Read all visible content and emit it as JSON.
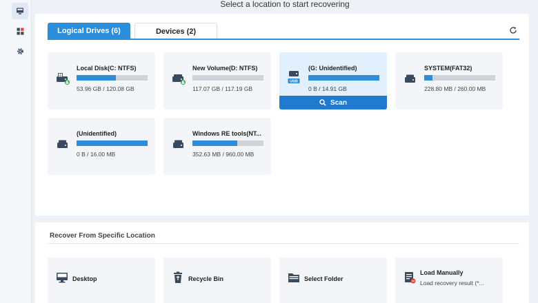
{
  "header": {
    "title": "Select a location to start recovering"
  },
  "left_rail": {
    "items": [
      {
        "icon": "computer-icon",
        "active": true
      },
      {
        "icon": "apps-icon",
        "active": false
      },
      {
        "icon": "gear-icon",
        "active": false
      }
    ]
  },
  "tabs": [
    {
      "label": "Logical Drives (6)",
      "active": true
    },
    {
      "label": "Devices (2)",
      "active": false
    }
  ],
  "drives": [
    {
      "name": "Local Disk(C: NTFS)",
      "size": "53.96 GB / 120.08 GB",
      "used_fraction": 0.55,
      "icon": "system-drive-icon"
    },
    {
      "name": "New Volume(D: NTFS)",
      "size": "117.07 GB / 117.19 GB",
      "used_fraction": 0.0,
      "icon": "system-drive-icon"
    },
    {
      "name": "(G: Unidentified)",
      "size": "0 B / 14.91 GB",
      "used_fraction": 1.0,
      "icon": "usb-drive-icon",
      "selected": true,
      "action_label": "Scan"
    },
    {
      "name": "SYSTEM(FAT32)",
      "size": "228.80 MB / 260.00 MB",
      "used_fraction": 0.12,
      "icon": "hard-drive-icon"
    },
    {
      "name": "(Unidentified)",
      "size": "0 B / 16.00 MB",
      "used_fraction": 1.0,
      "icon": "hard-drive-icon"
    },
    {
      "name": "Windows RE tools(NT...",
      "size": "352.63 MB / 960.00 MB",
      "used_fraction": 0.63,
      "icon": "hard-drive-icon"
    }
  ],
  "specific_location": {
    "title": "Recover From Specific Location",
    "items": [
      {
        "label": "Desktop",
        "icon": "desktop-icon"
      },
      {
        "label": "Recycle Bin",
        "icon": "recycle-bin-icon"
      },
      {
        "label": "Select Folder",
        "icon": "folder-icon"
      },
      {
        "label": "Load Manually",
        "sublabel": "Load recovery result (*...",
        "icon": "load-file-icon"
      }
    ]
  },
  "colors": {
    "accent": "#2c8ddb",
    "scan_button": "#1f7ad0",
    "selected_card": "#e2effc",
    "bar_bg": "#cfd3d9"
  }
}
